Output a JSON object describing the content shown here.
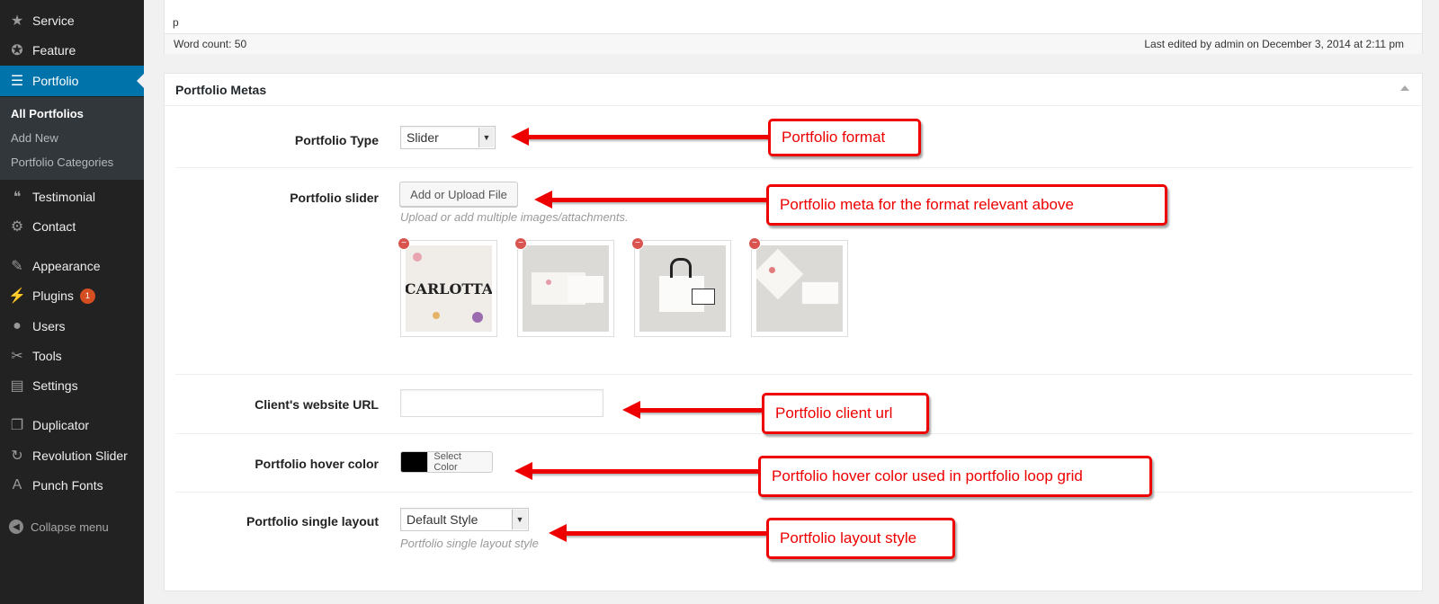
{
  "sidebar": {
    "items": [
      {
        "label": "Service",
        "icon": "star-icon"
      },
      {
        "label": "Feature",
        "icon": "award-icon"
      },
      {
        "label": "Portfolio",
        "icon": "list-icon"
      },
      {
        "label": "Testimonial",
        "icon": "quote-icon"
      },
      {
        "label": "Contact",
        "icon": "gear-icon"
      },
      {
        "label": "Appearance",
        "icon": "brush-icon"
      },
      {
        "label": "Plugins",
        "icon": "plug-icon",
        "badge": "1"
      },
      {
        "label": "Users",
        "icon": "user-icon"
      },
      {
        "label": "Tools",
        "icon": "wrench-icon"
      },
      {
        "label": "Settings",
        "icon": "sliders-icon"
      },
      {
        "label": "Duplicator",
        "icon": "copy-icon"
      },
      {
        "label": "Revolution Slider",
        "icon": "refresh-icon"
      },
      {
        "label": "Punch Fonts",
        "icon": "font-icon"
      }
    ],
    "submenu": [
      "All Portfolios",
      "Add New",
      "Portfolio Categories"
    ],
    "collapse_label": "Collapse menu",
    "active_color": "#0073aa"
  },
  "editor": {
    "content": "p",
    "word_count": "Word count: 50",
    "last_edited": "Last edited by admin on December 3, 2014 at 2:11 pm"
  },
  "metas": {
    "title": "Portfolio Metas",
    "portfolio_type": {
      "label": "Portfolio Type",
      "value": "Slider"
    },
    "portfolio_slider": {
      "label": "Portfolio slider",
      "button": "Add or Upload File",
      "description": "Upload or add multiple images/attachments.",
      "thumb_text": "CARLOTTA"
    },
    "client_url": {
      "label": "Client's website URL",
      "value": ""
    },
    "hover_color": {
      "label": "Portfolio hover color",
      "button": "Select Color",
      "color": "#000000"
    },
    "single_layout": {
      "label": "Portfolio single layout",
      "value": "Default Style",
      "description": "Portfolio single layout style"
    }
  },
  "annotations": [
    "Portfolio format",
    "Portfolio meta for the format relevant above",
    "Portfolio client url",
    "Portfolio hover color used in portfolio loop grid",
    "Portfolio layout style"
  ]
}
